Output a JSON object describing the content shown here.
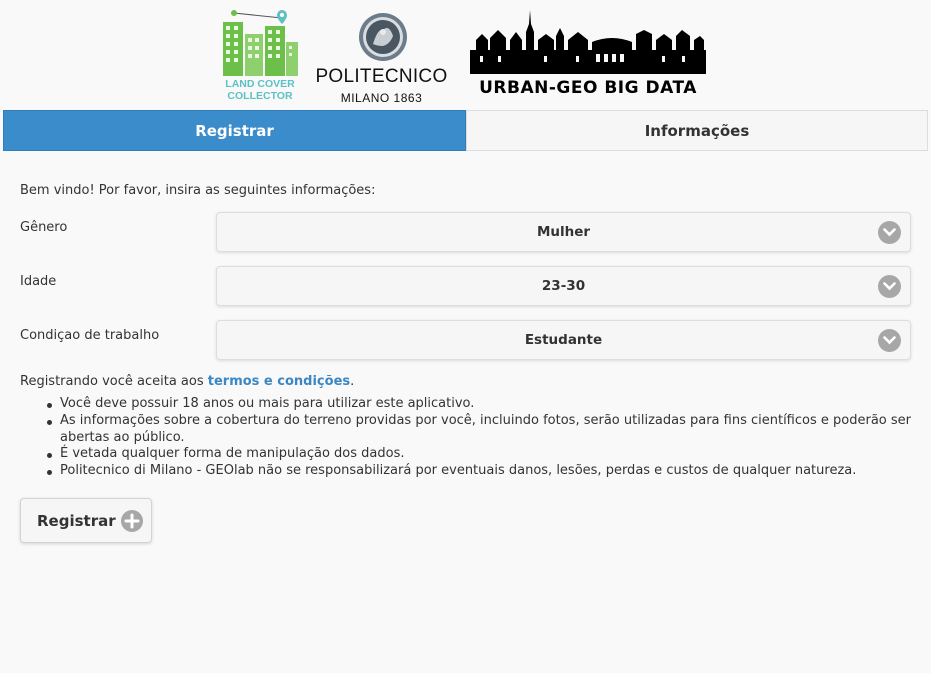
{
  "logos": {
    "lcc_line1": "LAND COVER",
    "lcc_line2": "COLLECTOR",
    "poli_name": "POLITECNICO",
    "poli_sub": "MILANO 1863",
    "ugbd": "URBAN-GEO BIG DATA"
  },
  "tabs": [
    {
      "label": "Registrar",
      "active": true
    },
    {
      "label": "Informações",
      "active": false
    }
  ],
  "form": {
    "welcome": "Bem vindo! Por favor, insira as seguintes informações:",
    "gender": {
      "label": "Gênero",
      "value": "Mulher"
    },
    "age": {
      "label": "Idade",
      "value": "23-30"
    },
    "work": {
      "label": "Condiçao de trabalho",
      "value": "Estudante"
    }
  },
  "terms": {
    "prefix": "Registrando você aceita aos ",
    "link": "termos e condições",
    "suffix": ".",
    "items": [
      "Você deve possuir 18 anos ou mais para utilizar este aplicativo.",
      "As informações sobre a cobertura do terreno providas por você, incluindo fotos, serão utilizadas para fins científicos e poderão ser abertas ao público.",
      "É vetada qualquer forma de manipulação dos dados.",
      "Politecnico di Milano - GEOlab não se responsabilizará por eventuais danos, lesões, perdas e custos de qualquer natureza."
    ]
  },
  "register_button": "Registrar",
  "colors": {
    "accent": "#3b8ccb",
    "link": "#3a87c4",
    "lcc_green": "#6cc04a",
    "lcc_teal": "#5dc1c4"
  }
}
